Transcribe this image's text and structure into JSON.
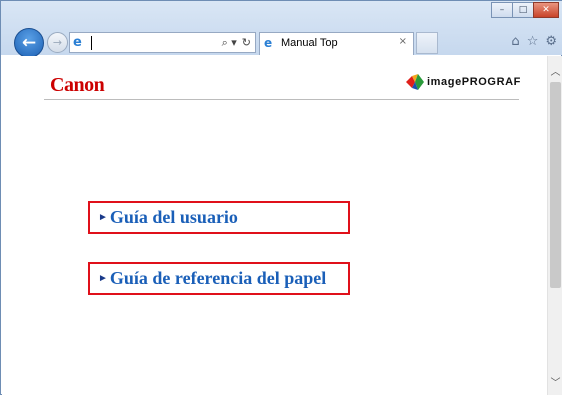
{
  "browser": {
    "window_controls": [
      "–",
      "□",
      "✕"
    ],
    "address_tools": [
      "⌕ ▾",
      "↻"
    ],
    "tab": {
      "title": "Manual Top",
      "close": "×"
    },
    "right_tools": [
      "⌂",
      "☆",
      "⚙"
    ],
    "icons": {
      "back": "back-arrow-icon",
      "forward": "forward-arrow-icon",
      "site": "internet-explorer-icon",
      "home": "home-icon",
      "favorites": "star-icon",
      "tools": "gear-icon"
    }
  },
  "page": {
    "canon_logo": "Canon",
    "brand": "imagePROGRAF",
    "links": [
      {
        "label": "Guía del usuario"
      },
      {
        "label": "Guía de referencia del papel"
      }
    ],
    "colors": {
      "logo": "#cc0000",
      "link": "#1a5fb8",
      "box": "#e0101a"
    }
  }
}
